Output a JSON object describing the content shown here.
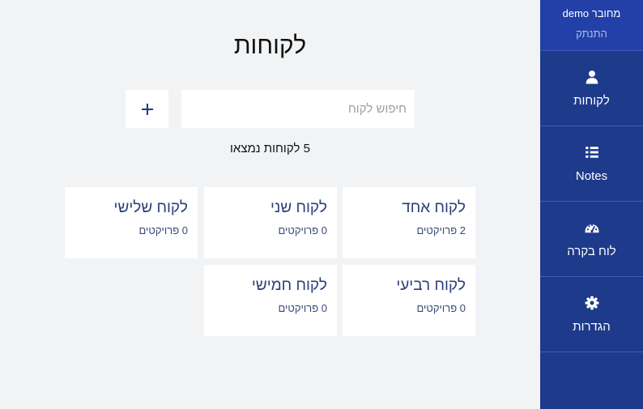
{
  "user": {
    "status_line": "demo מחובר",
    "logout_label": "התנתק"
  },
  "nav": [
    {
      "icon": "user-icon",
      "label": "לקוחות"
    },
    {
      "icon": "list-icon",
      "label": "Notes"
    },
    {
      "icon": "dashboard-icon",
      "label": "לוח בקרה"
    },
    {
      "icon": "gear-icon",
      "label": "הגדרות"
    }
  ],
  "page": {
    "title": "לקוחות"
  },
  "search": {
    "placeholder": "חיפוש לקוח"
  },
  "add_button": {
    "label": "+"
  },
  "results": {
    "count_text": "5 לקוחות נמצאו"
  },
  "clients": [
    {
      "name": "לקוח אחד",
      "projects": "2 פרויקטים"
    },
    {
      "name": "לקוח שני",
      "projects": "0 פרויקטים"
    },
    {
      "name": "לקוח שלישי",
      "projects": "0 פרויקטים"
    },
    {
      "name": "לקוח רביעי",
      "projects": "0 פרויקטים"
    },
    {
      "name": "לקוח חמישי",
      "projects": "0 פרויקטים"
    }
  ],
  "colors": {
    "sidebar": "#1e3a8a",
    "accent": "#2a3f7a",
    "background": "#f2f3f5"
  }
}
